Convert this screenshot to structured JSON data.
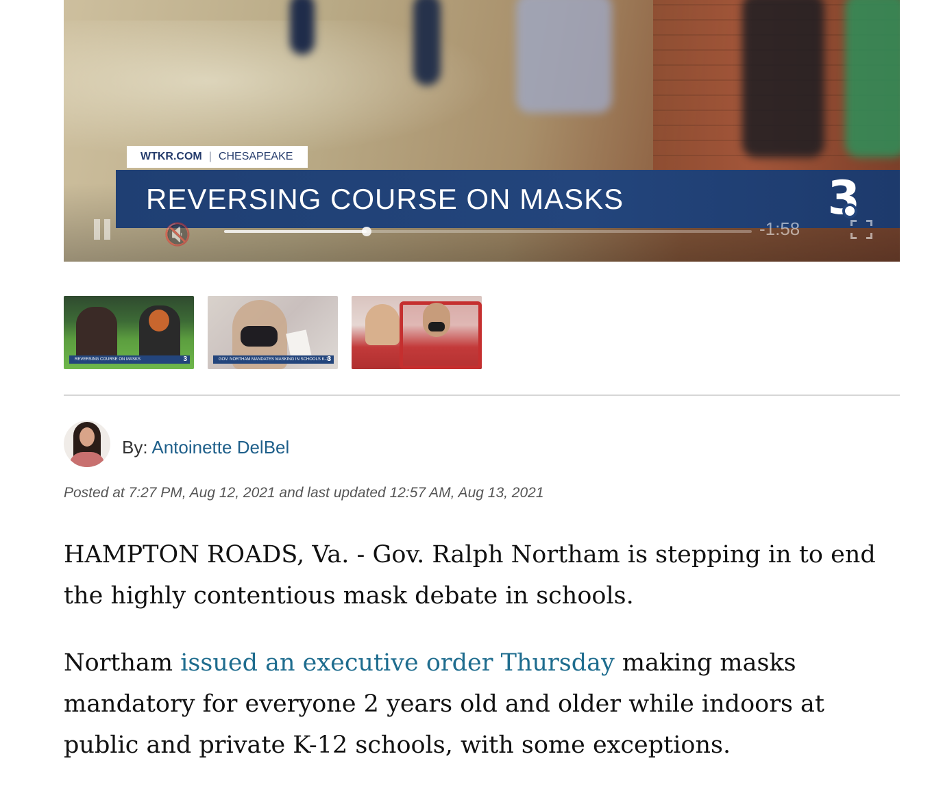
{
  "video": {
    "tag_brand": "WTKR.COM",
    "tag_separator": "|",
    "tag_location": "CHESAPEAKE",
    "headline": "REVERSING COURSE ON MASKS",
    "station_logo": "3",
    "time_remaining": "-1:58",
    "progress_fraction": 0.27,
    "controls": {
      "play_state_icon": "pause-icon",
      "mute_icon": "muted-speaker-icon",
      "fullscreen_icon": "fullscreen-icon"
    }
  },
  "playlist": {
    "thumbnails": [
      {
        "caption": "REVERSING COURSE ON MASKS",
        "logo": "3"
      },
      {
        "caption": "GOV. NORTHAM MANDATES MASKING IN SCHOOLS K-12",
        "logo": "3"
      },
      {
        "caption": "",
        "logo": ""
      }
    ]
  },
  "byline": {
    "prefix": "By:",
    "author": "Antoinette DelBel"
  },
  "timestamp": "Posted at 7:27 PM, Aug 12, 2021 and last updated 12:57 AM, Aug 13, 2021",
  "article": {
    "p1": "HAMPTON ROADS, Va. - Gov. Ralph Northam is stepping in to end the highly contentious mask debate in schools.",
    "p2_before": "Northam ",
    "p2_link": "issued an executive order Thursday",
    "p2_after": " making masks mandatory for everyone 2 years old and older while indoors at public and private K-12 schools, with some exceptions."
  },
  "colors": {
    "lower_third": "#23457c",
    "link": "#1e6c8e",
    "byline_link": "#1e5f8a",
    "divider": "#d6d6d6"
  }
}
